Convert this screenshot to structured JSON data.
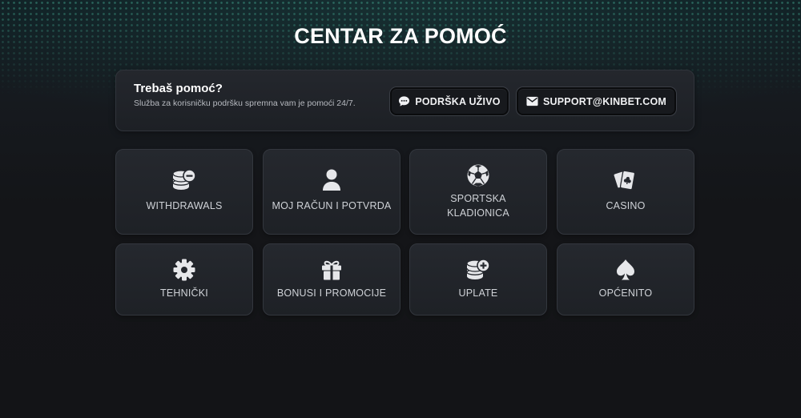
{
  "header": {
    "title": "CENTAR ZA POMOĆ"
  },
  "support": {
    "heading": "Trebaš pomoć?",
    "description": "Služba za korisničku podršku spremna vam je pomoći 24/7.",
    "live_chat_label": "PODRŠKA UŽIVO",
    "email_label": "SUPPORT@KINBET.COM"
  },
  "categories": [
    {
      "label": "WITHDRAWALS",
      "icon": "coins-minus-icon"
    },
    {
      "label": "MOJ RAČUN I POTVRDA",
      "icon": "user-icon"
    },
    {
      "label_line1": "SPORTSKA",
      "label_line2": "KLADIONICA",
      "icon": "soccer-ball-icon"
    },
    {
      "label": "CASINO",
      "icon": "playing-cards-icon"
    },
    {
      "label": "TEHNIČKI",
      "icon": "gear-icon"
    },
    {
      "label": "BONUSI I PROMOCIJE",
      "icon": "gift-icon"
    },
    {
      "label": "UPLATE",
      "icon": "coins-plus-icon"
    },
    {
      "label": "OPĆENITO",
      "icon": "spade-icon"
    }
  ],
  "colors": {
    "background": "#141518",
    "card": "#22252a",
    "text_primary": "#ffffff",
    "text_secondary": "#cfd2d7",
    "accent_dots": "#46af96"
  }
}
